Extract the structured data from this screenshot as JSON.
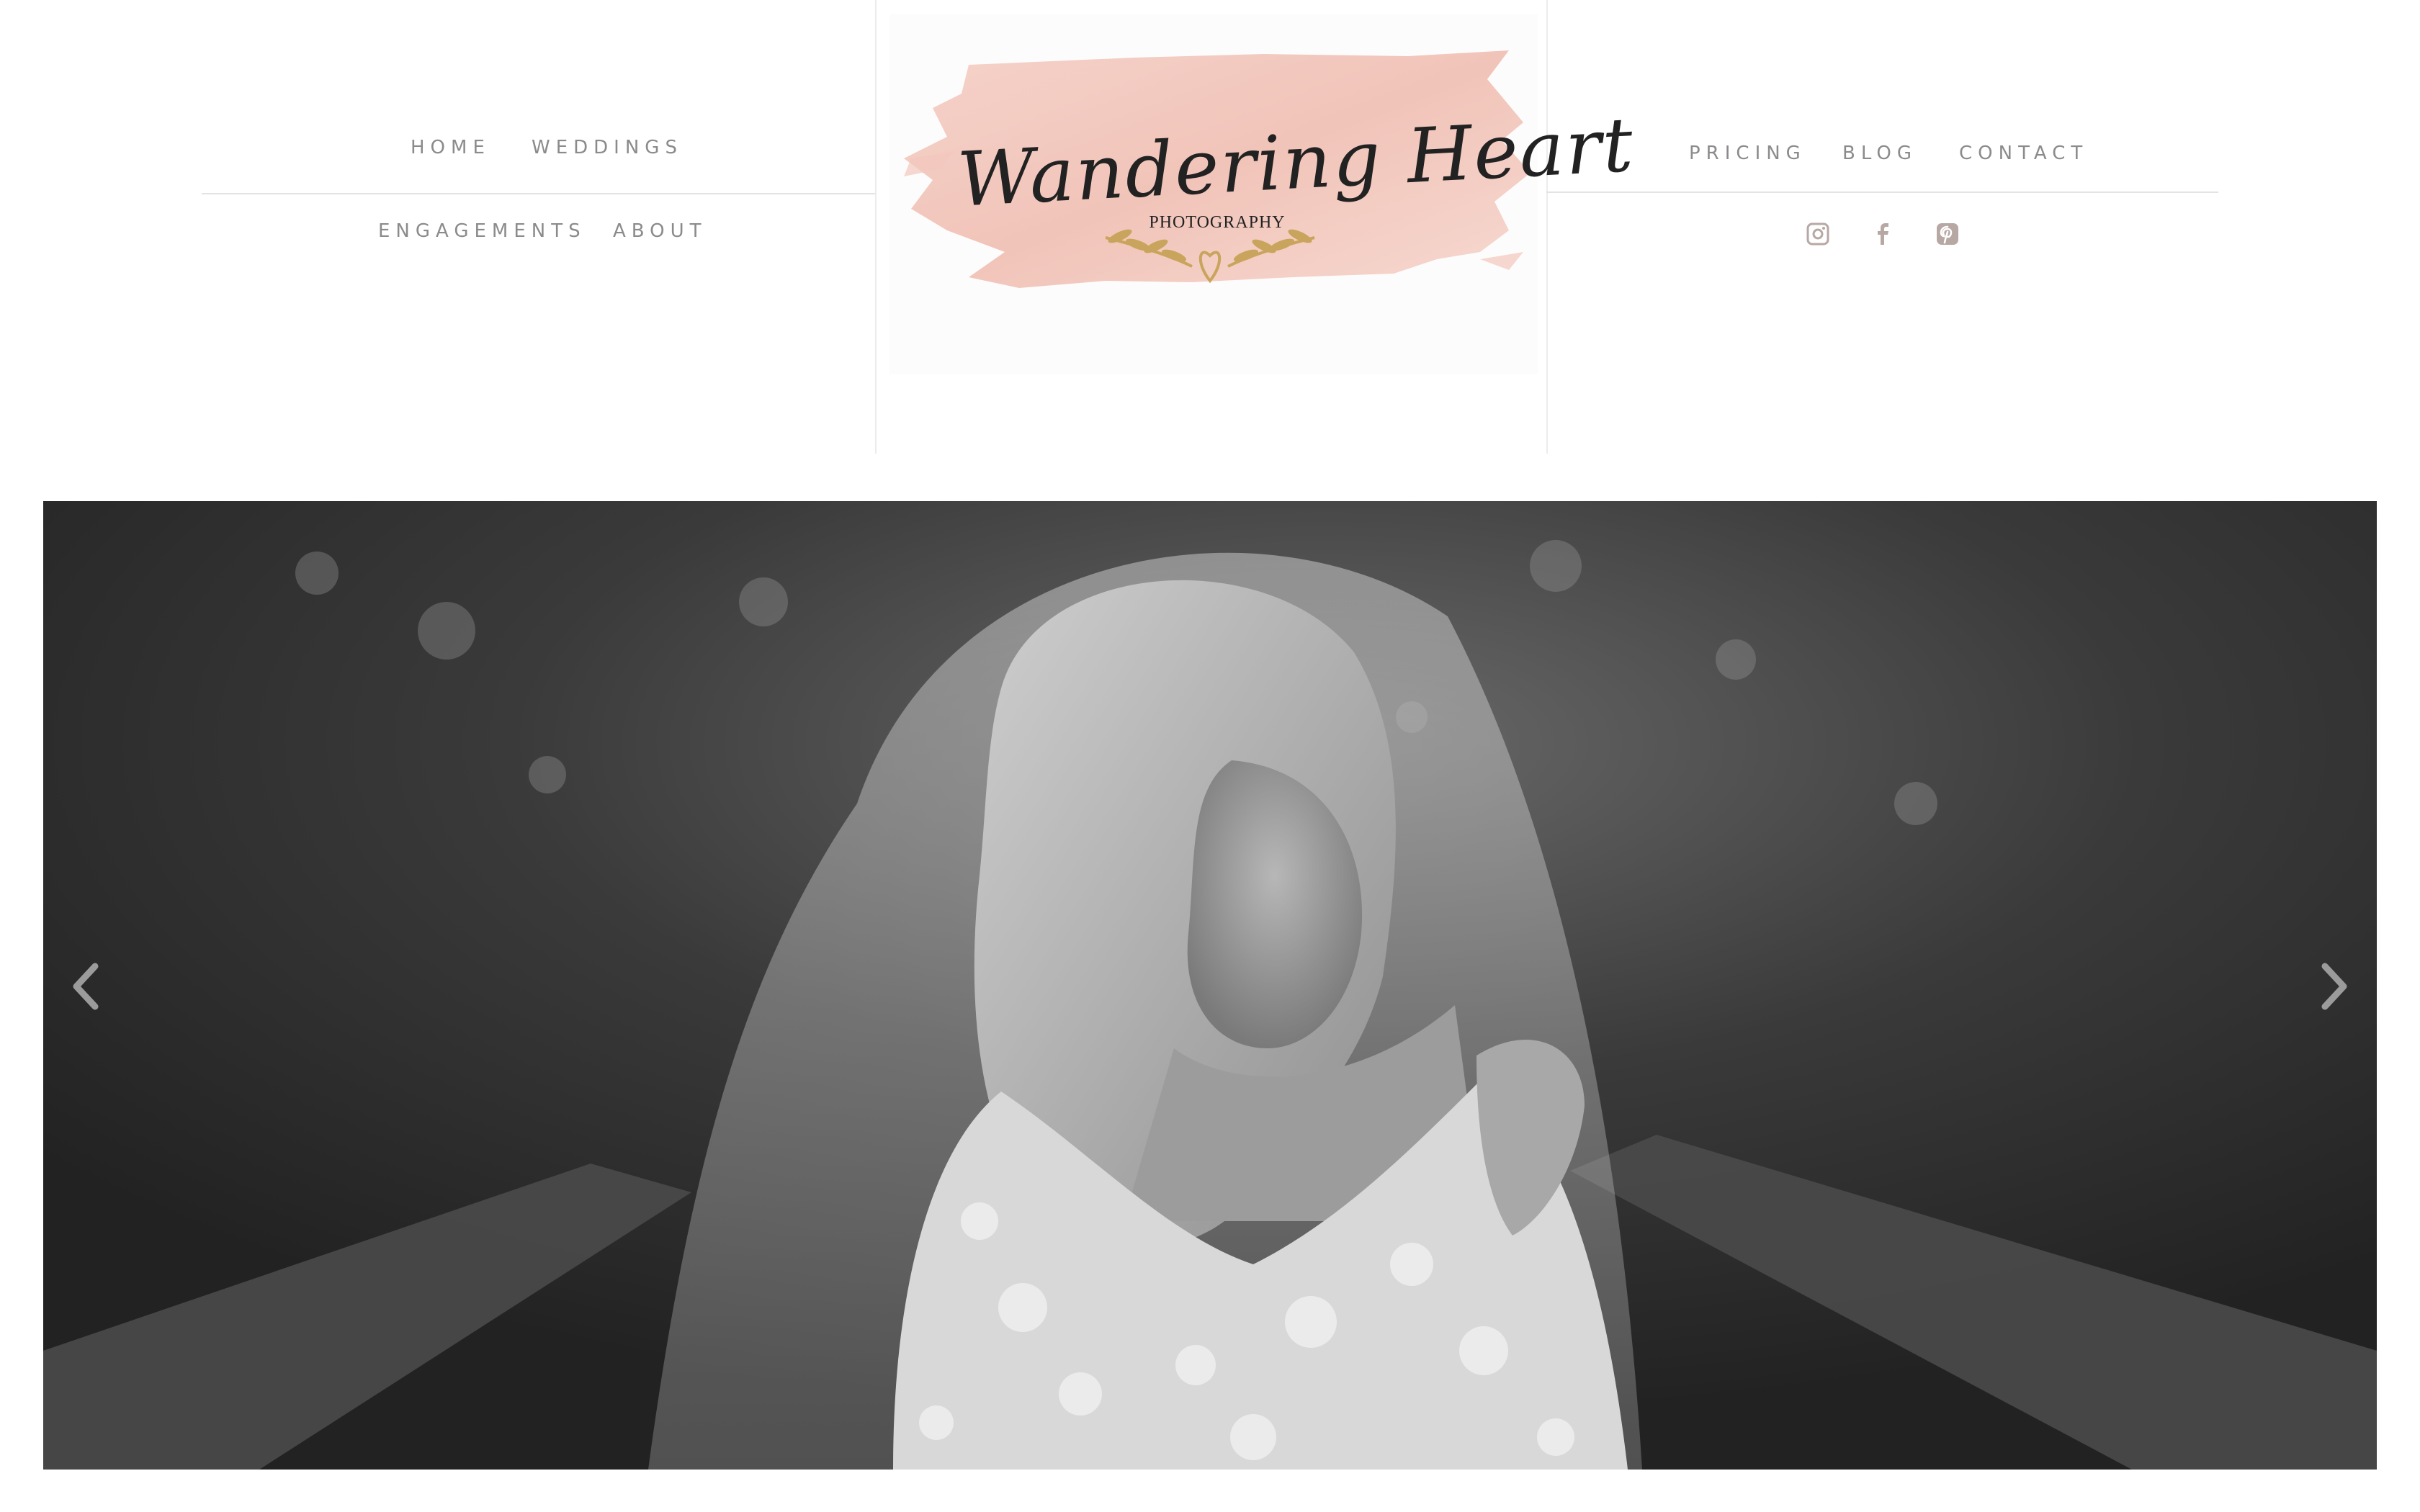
{
  "nav_left": {
    "row1": [
      "HOME",
      "WEDDINGS"
    ],
    "row2": [
      "ENGAGEMENTS",
      "ABOUT"
    ]
  },
  "nav_right": {
    "row1": [
      "PRICING",
      "BLOG",
      "CONTACT"
    ]
  },
  "logo": {
    "title": "Wandering Heart",
    "subtitle": "PHOTOGRAPHY"
  },
  "social": [
    {
      "icon": "instagram-icon"
    },
    {
      "icon": "facebook-icon"
    },
    {
      "icon": "pinterest-icon"
    }
  ],
  "hero": {
    "prev_icon": "chevron-left-icon",
    "next_icon": "chevron-right-icon"
  },
  "colors": {
    "nav_text": "#8c8a8c",
    "logo_wash": "#f1c3b8",
    "logo_gold": "#c9a45c",
    "icon": "#b7a8a4"
  }
}
